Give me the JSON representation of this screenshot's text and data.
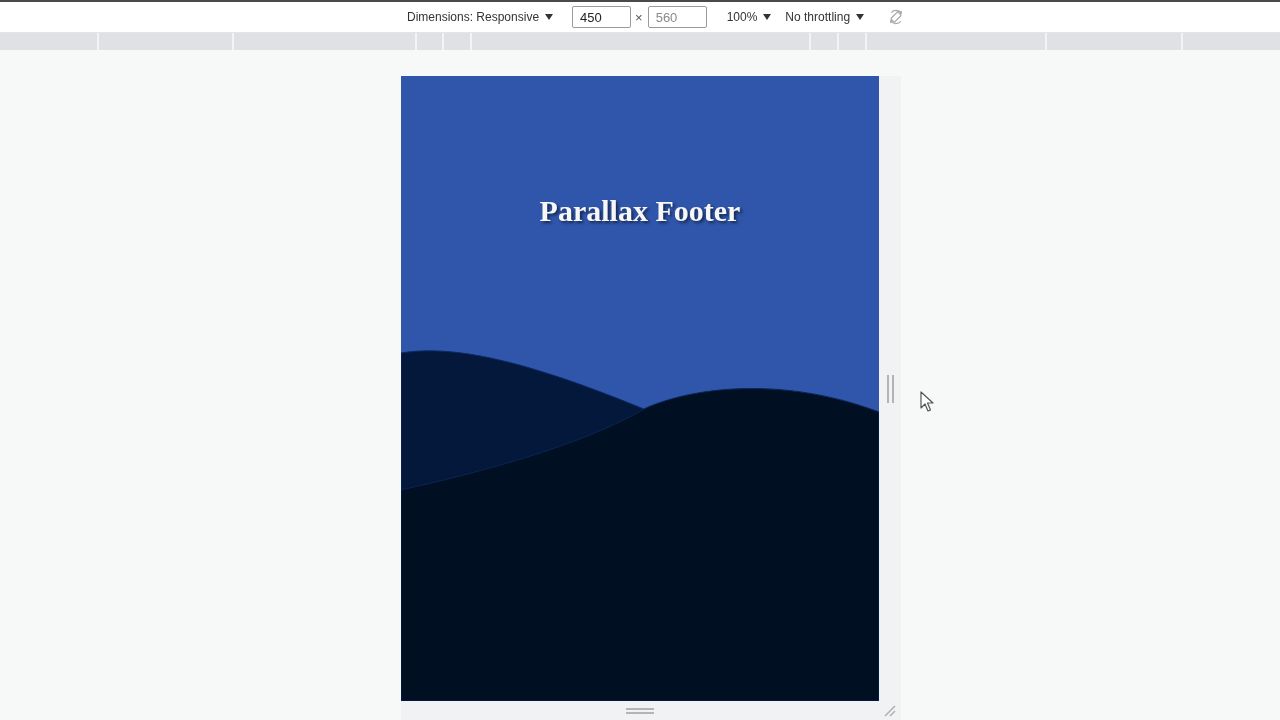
{
  "toolbar": {
    "device_mode": "Dimensions: Responsive",
    "width": {
      "value": "450"
    },
    "separator": "×",
    "height": {
      "placeholder": "560"
    },
    "zoom": "100%",
    "throttling": "No throttling"
  },
  "preview": {
    "heading": "Parallax Footer"
  }
}
